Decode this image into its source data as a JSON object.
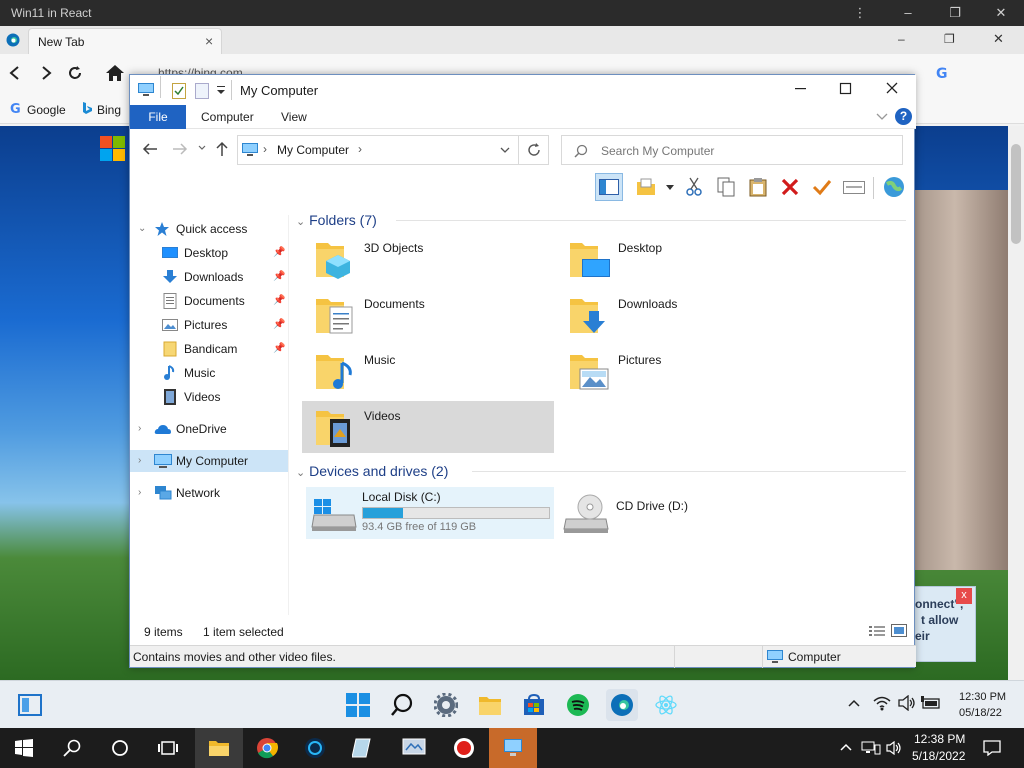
{
  "host": {
    "title": "Win11 in React",
    "min": "–",
    "restore": "❐",
    "close": "✕",
    "menu": "⋮"
  },
  "browser": {
    "tab": {
      "label": "New Tab",
      "close": "×"
    },
    "url": "https://bing.com",
    "bookmarks": [
      {
        "label": "Google"
      },
      {
        "label": "Bing"
      }
    ],
    "win": {
      "min": "–",
      "restore": "❐",
      "close": "✕"
    }
  },
  "explorer": {
    "title": "My Computer",
    "ribbon_tabs": [
      "File",
      "Computer",
      "View"
    ],
    "breadcrumb": "My Computer",
    "search_placeholder": "Search My Computer",
    "help": "?",
    "nav": {
      "quick_access": "Quick access",
      "quick_items": [
        "Desktop",
        "Downloads",
        "Documents",
        "Pictures",
        "Bandicam",
        "Music",
        "Videos"
      ],
      "onedrive": "OneDrive",
      "my_computer": "My Computer",
      "network": "Network"
    },
    "folders_header": "Folders (7)",
    "folders": [
      "3D Objects",
      "Desktop",
      "Documents",
      "Downloads",
      "Music",
      "Pictures",
      "Videos"
    ],
    "drives_header": "Devices and drives (2)",
    "drives": [
      {
        "name": "Local Disk (C:)",
        "free": "93.4 GB free of 119 GB",
        "used_fraction": 0.215
      },
      {
        "name": "CD Drive (D:)"
      }
    ],
    "status": {
      "items": "9 items",
      "selected": "1 item selected",
      "info": "Contains movies and other video files.",
      "location": "Computer"
    }
  },
  "toast": {
    "lines": [
      "onnect\",",
      "t allow",
      "eir"
    ],
    "close": "x"
  },
  "taskbar11": {
    "time": "12:30 PM",
    "date": "05/18/22"
  },
  "taskbar10": {
    "time": "12:38 PM",
    "date": "5/18/2022"
  },
  "colors": {
    "accent": "#1f63c2",
    "selection": "#cce4f7",
    "drive_bar": "#26a0da",
    "folder": "#f5c342"
  }
}
